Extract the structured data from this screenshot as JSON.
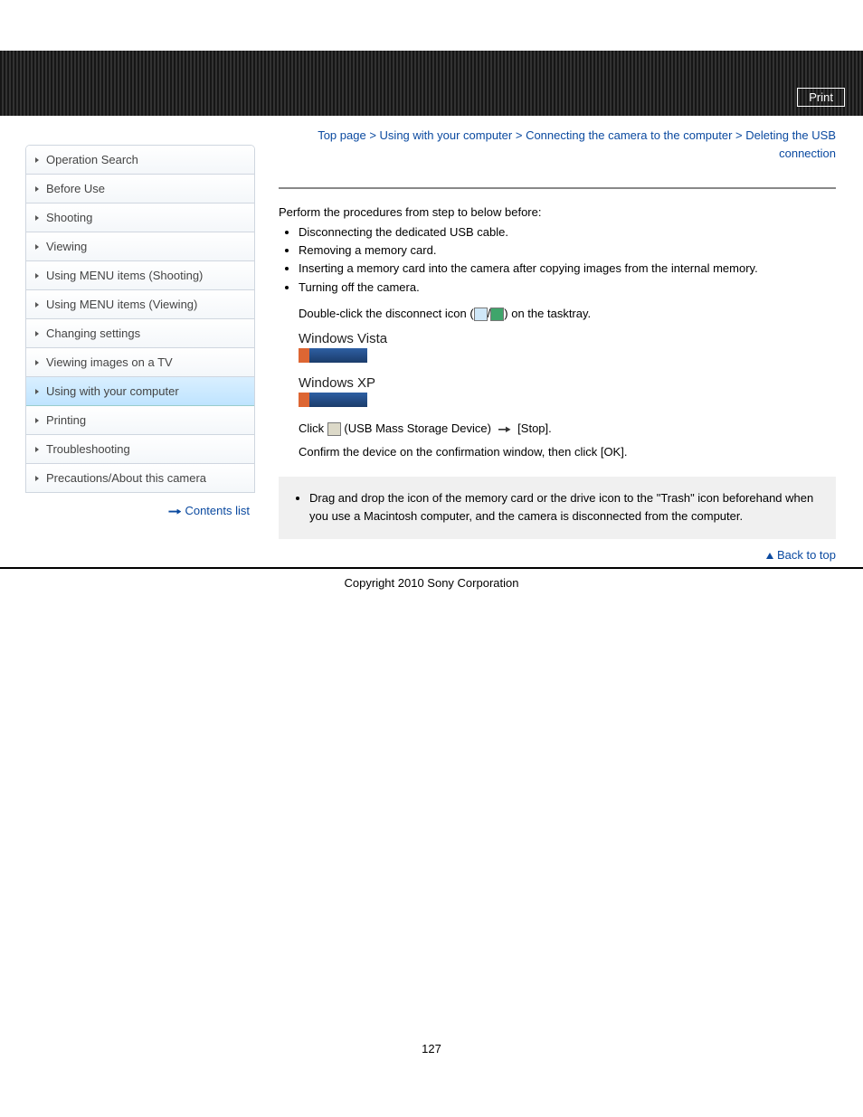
{
  "topbar": {
    "print_label": "Print"
  },
  "breadcrumb": {
    "top": "Top page",
    "l1": "Using with your computer",
    "l2": "Connecting the camera to the computer",
    "current": "Deleting the USB connection",
    "sep": ">"
  },
  "sidebar": {
    "items": [
      "Operation Search",
      "Before Use",
      "Shooting",
      "Viewing",
      "Using MENU items (Shooting)",
      "Using MENU items (Viewing)",
      "Changing settings",
      "Viewing images on a TV",
      "Using with your computer",
      "Printing",
      "Troubleshooting",
      "Precautions/About this camera"
    ],
    "active_index": 8,
    "contents_list_label": "Contents list"
  },
  "content": {
    "intro": "Perform the procedures from step     to     below before:",
    "bullets": [
      "Disconnecting the dedicated USB cable.",
      "Removing a memory card.",
      "Inserting a memory card into the camera after copying images from the internal memory.",
      "Turning off the camera."
    ],
    "step1_pre": "Double-click the disconnect icon (",
    "step1_sep": "/",
    "step1_post": ") on the tasktray.",
    "os1": "Windows Vista",
    "os2": "Windows XP",
    "step2_pre": "Click ",
    "step2_mid": " (USB Mass Storage Device) ",
    "step2_post": " [Stop].",
    "step3": "Confirm the device on the confirmation window, then click [OK].",
    "note": "Drag and drop the icon of the memory card or the drive icon to the \"Trash\" icon beforehand when you use a Macintosh computer, and the camera is disconnected from the computer."
  },
  "footer": {
    "backtop": "Back to top",
    "copyright": "Copyright 2010 Sony Corporation"
  },
  "page_number": "127"
}
